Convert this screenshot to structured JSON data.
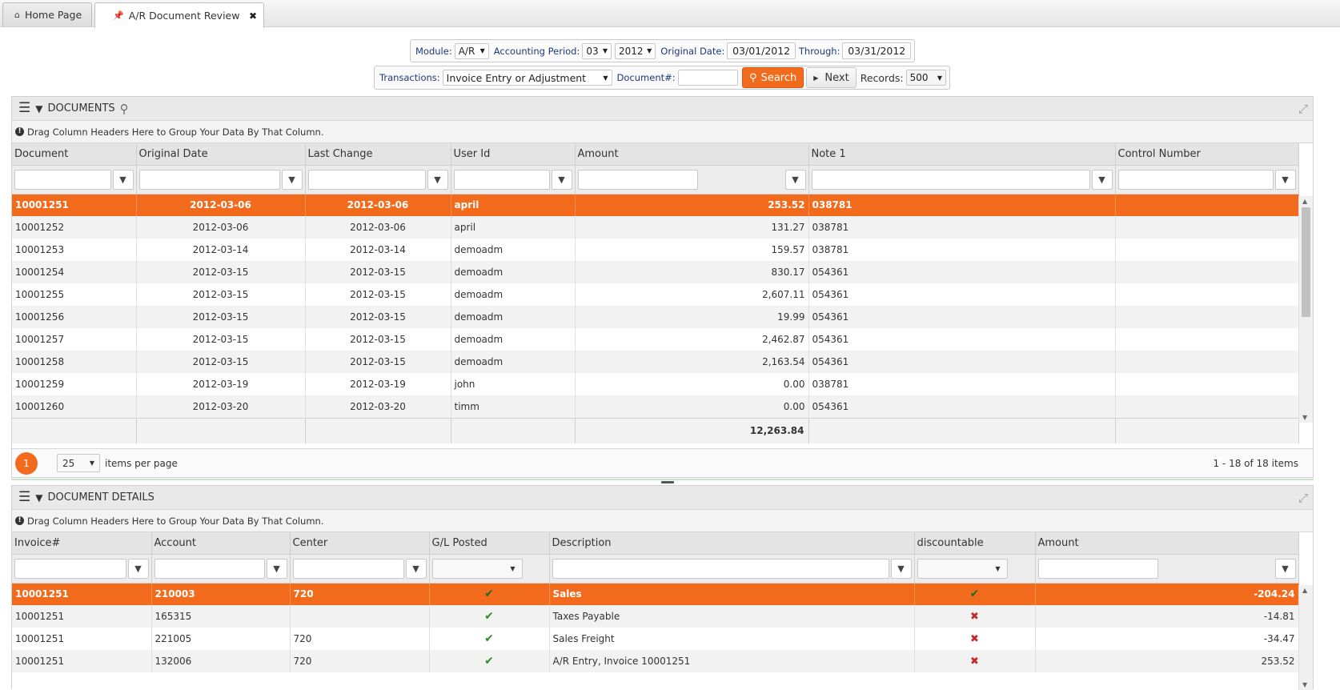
{
  "tabs": [
    {
      "label": "Home Page",
      "icon": "home-icon"
    },
    {
      "label": "A/R Document Review",
      "icon": "pin-icon",
      "close": "✖"
    }
  ],
  "filters": {
    "module_label": "Module:",
    "module_value": "A/R",
    "period_label": "Accounting Period:",
    "period_month": "03",
    "period_year": "2012",
    "original_date_label": "Original Date:",
    "original_date": "03/01/2012",
    "through_label": "Through:",
    "through_date": "03/31/2012",
    "transactions_label": "Transactions:",
    "transactions_value": "Invoice Entry or Adjustment",
    "document_label": "Document#:",
    "document_value": "",
    "search_label": "Search",
    "next_label": "Next",
    "records_label": "Records:",
    "records_value": "500"
  },
  "documents": {
    "title": "DOCUMENTS",
    "group_hint": "Drag Column Headers Here to Group Your Data By That Column.",
    "columns": [
      "Document",
      "Original Date",
      "Last Change",
      "User Id",
      "Amount",
      "Note 1",
      "Control Number"
    ],
    "rows": [
      [
        "10001251",
        "2012-03-06",
        "2012-03-06",
        "april",
        "253.52",
        "038781",
        ""
      ],
      [
        "10001252",
        "2012-03-06",
        "2012-03-06",
        "april",
        "131.27",
        "038781",
        ""
      ],
      [
        "10001253",
        "2012-03-14",
        "2012-03-14",
        "demoadm",
        "159.57",
        "038781",
        ""
      ],
      [
        "10001254",
        "2012-03-15",
        "2012-03-15",
        "demoadm",
        "830.17",
        "054361",
        ""
      ],
      [
        "10001255",
        "2012-03-15",
        "2012-03-15",
        "demoadm",
        "2,607.11",
        "054361",
        ""
      ],
      [
        "10001256",
        "2012-03-15",
        "2012-03-15",
        "demoadm",
        "19.99",
        "054361",
        ""
      ],
      [
        "10001257",
        "2012-03-15",
        "2012-03-15",
        "demoadm",
        "2,462.87",
        "054361",
        ""
      ],
      [
        "10001258",
        "2012-03-15",
        "2012-03-15",
        "demoadm",
        "2,163.54",
        "054361",
        ""
      ],
      [
        "10001259",
        "2012-03-19",
        "2012-03-19",
        "john",
        "0.00",
        "038781",
        ""
      ],
      [
        "10001260",
        "2012-03-20",
        "2012-03-20",
        "timm",
        "0.00",
        "054361",
        ""
      ]
    ],
    "selected_row": 0,
    "footer_total": "12,263.84",
    "pager": {
      "page": "1",
      "per_page": "25",
      "per_page_label": "items per page",
      "info": "1 - 18 of 18 items"
    }
  },
  "details": {
    "title": "DOCUMENT DETAILS",
    "group_hint": "Drag Column Headers Here to Group Your Data By That Column.",
    "columns": [
      "Invoice#",
      "Account",
      "Center",
      "G/L Posted",
      "Description",
      "discountable",
      "Amount"
    ],
    "rows": [
      {
        "invoice": "10001251",
        "account": "210003",
        "center": "720",
        "gl_posted": true,
        "description": "Sales",
        "discountable": true,
        "amount": "-204.24"
      },
      {
        "invoice": "10001251",
        "account": "165315",
        "center": "",
        "gl_posted": true,
        "description": "Taxes Payable",
        "discountable": false,
        "amount": "-14.81"
      },
      {
        "invoice": "10001251",
        "account": "221005",
        "center": "720",
        "gl_posted": true,
        "description": "Sales Freight",
        "discountable": false,
        "amount": "-34.47"
      },
      {
        "invoice": "10001251",
        "account": "132006",
        "center": "720",
        "gl_posted": true,
        "description": "A/R Entry, Invoice 10001251",
        "discountable": false,
        "amount": "253.52"
      }
    ],
    "selected_row": 0
  },
  "colors": {
    "accent": "#f26b1d",
    "check": "#2e8b2e",
    "cross": "#c62828"
  }
}
